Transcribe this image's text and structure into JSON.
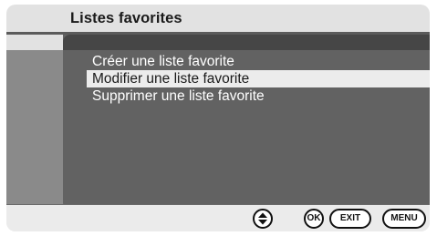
{
  "header": {
    "title": "Listes favorites"
  },
  "menu": {
    "items": [
      {
        "label": "Créer une liste favorite",
        "selected": false
      },
      {
        "label": "Modifier une liste favorite",
        "selected": true
      },
      {
        "label": "Supprimer une liste favorite",
        "selected": false
      }
    ]
  },
  "footer": {
    "nav_icon": "up-down-arrows-icon",
    "ok_label": "OK",
    "exit_label": "EXIT",
    "menu_label": "MENU"
  },
  "colors": {
    "frame": "#e2e2e2",
    "panel": "#626262",
    "panel_topbar": "#464646",
    "selected_row": "#ececec"
  }
}
